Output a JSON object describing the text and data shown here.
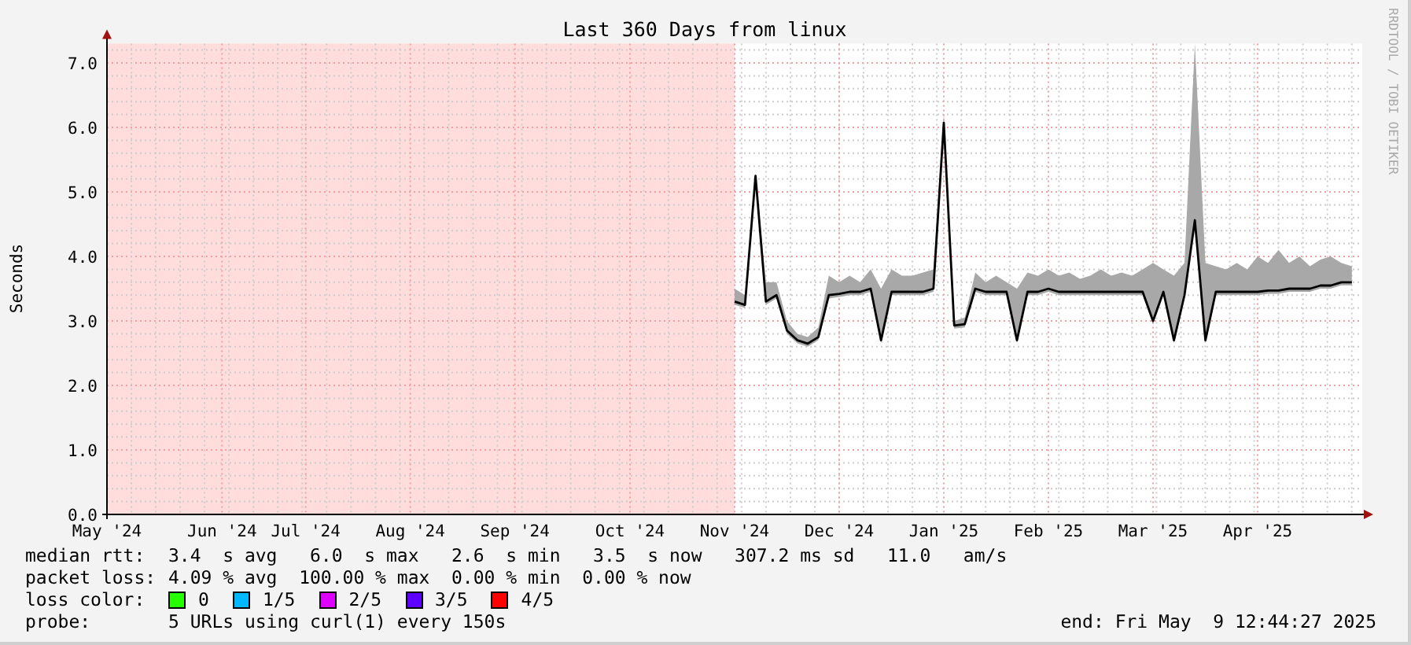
{
  "credit": "RRDTOOL / TOBI OETIKER",
  "graph": {
    "chart_data": {
      "type": "line",
      "title": "Last 360 Days from linux",
      "ylabel": "Seconds",
      "categories": [
        "May '24",
        null,
        null,
        null,
        null,
        null,
        null,
        null,
        null,
        null,
        null,
        "Jun '24",
        null,
        null,
        null,
        null,
        null,
        null,
        null,
        "Jul '24",
        null,
        null,
        null,
        null,
        null,
        null,
        null,
        null,
        null,
        "Aug '24",
        null,
        null,
        null,
        null,
        null,
        null,
        null,
        null,
        null,
        "Sep '24",
        null,
        null,
        null,
        null,
        null,
        null,
        null,
        null,
        null,
        null,
        "Oct '24",
        null,
        null,
        null,
        null,
        null,
        null,
        null,
        null,
        null,
        "Nov '24",
        null,
        null,
        null,
        null,
        null,
        null,
        null,
        null,
        null,
        "Dec '24",
        null,
        null,
        null,
        null,
        null,
        null,
        null,
        null,
        null,
        "Jan '25",
        null,
        null,
        null,
        null,
        null,
        null,
        null,
        null,
        null,
        "Feb '25",
        null,
        null,
        null,
        null,
        null,
        null,
        null,
        null,
        null,
        "Mar '25",
        null,
        null,
        null,
        null,
        null,
        null,
        null,
        null,
        null,
        "Apr '25",
        null,
        null,
        null,
        null,
        null,
        null,
        null,
        null,
        null
      ],
      "grid": true,
      "series": [
        {
          "type": "area",
          "color": "#a8a8a8",
          "values": [
            null,
            null,
            null,
            null,
            null,
            null,
            null,
            null,
            null,
            null,
            null,
            null,
            null,
            null,
            null,
            null,
            null,
            null,
            null,
            null,
            null,
            null,
            null,
            null,
            null,
            null,
            null,
            null,
            null,
            null,
            null,
            null,
            null,
            null,
            null,
            null,
            null,
            null,
            null,
            null,
            null,
            null,
            null,
            null,
            null,
            null,
            null,
            null,
            null,
            null,
            null,
            null,
            null,
            null,
            null,
            null,
            null,
            null,
            null,
            null,
            3.5,
            3.4,
            5.3,
            3.6,
            3.6,
            3.0,
            2.8,
            2.75,
            2.9,
            3.7,
            3.6,
            3.7,
            3.6,
            3.8,
            3.5,
            3.8,
            3.7,
            3.7,
            3.75,
            3.8,
            6.2,
            3.0,
            3.05,
            3.75,
            3.6,
            3.7,
            3.6,
            3.5,
            3.75,
            3.7,
            3.8,
            3.7,
            3.75,
            3.65,
            3.7,
            3.8,
            3.7,
            3.75,
            3.7,
            3.8,
            3.9,
            3.8,
            3.7,
            3.9,
            7.3,
            3.9,
            3.85,
            3.8,
            3.9,
            3.8,
            4.0,
            3.9,
            4.1,
            3.9,
            4.0,
            3.85,
            3.95,
            4.0,
            3.9,
            3.85
          ]
        },
        {
          "type": "line",
          "color": "#000000",
          "values": [
            null,
            null,
            null,
            null,
            null,
            null,
            null,
            null,
            null,
            null,
            null,
            null,
            null,
            null,
            null,
            null,
            null,
            null,
            null,
            null,
            null,
            null,
            null,
            null,
            null,
            null,
            null,
            null,
            null,
            null,
            null,
            null,
            null,
            null,
            null,
            null,
            null,
            null,
            null,
            null,
            null,
            null,
            null,
            null,
            null,
            null,
            null,
            null,
            null,
            null,
            null,
            null,
            null,
            null,
            null,
            null,
            null,
            null,
            null,
            null,
            3.3,
            3.25,
            5.25,
            3.3,
            3.4,
            2.85,
            2.7,
            2.65,
            2.75,
            3.4,
            3.42,
            3.45,
            3.45,
            3.5,
            2.7,
            3.45,
            3.45,
            3.45,
            3.45,
            3.5,
            6.07,
            2.93,
            2.95,
            3.5,
            3.45,
            3.45,
            3.45,
            2.7,
            3.45,
            3.45,
            3.5,
            3.45,
            3.45,
            3.45,
            3.45,
            3.45,
            3.45,
            3.45,
            3.45,
            3.45,
            3.0,
            3.45,
            2.7,
            3.4,
            4.56,
            2.7,
            3.45,
            3.45,
            3.45,
            3.45,
            3.45,
            3.47,
            3.47,
            3.5,
            3.5,
            3.5,
            3.55,
            3.55,
            3.6,
            3.6
          ]
        }
      ],
      "ylim": [
        0,
        7.3
      ],
      "yticks": [
        {
          "value": 0,
          "label": "0.0"
        },
        {
          "value": 1,
          "label": "1.0"
        },
        {
          "value": 2,
          "label": "2.0"
        },
        {
          "value": 3,
          "label": "3.0"
        },
        {
          "value": 4,
          "label": "4.0"
        },
        {
          "value": 5,
          "label": "5.0"
        },
        {
          "value": 6,
          "label": "6.0"
        },
        {
          "value": 7,
          "label": "7.0"
        }
      ]
    }
  },
  "legend_rows": [
    {
      "label": "median rtt:",
      "text": "3.4  s avg   6.0  s max   2.6  s min   3.5  s now   307.2 ms sd   11.0   am/s"
    },
    {
      "label": "packet loss:",
      "text": "4.09 % avg  100.00 % max  0.00 % min  0.00 % now"
    }
  ],
  "loss_colors": {
    "label": "loss color:",
    "items": [
      {
        "label": "0",
        "color": "#26ff00"
      },
      {
        "label": "1/5",
        "color": "#00b8ff"
      },
      {
        "label": "2/5",
        "color": "#dd00ff"
      },
      {
        "label": "3/5",
        "color": "#5e00ff"
      },
      {
        "label": "4/5",
        "color": "#ff0000"
      }
    ]
  },
  "probe": {
    "label": "probe:",
    "text": "5 URLs using curl(1) every 150s"
  },
  "end": "end: Fri May  9 12:44:27 2025"
}
